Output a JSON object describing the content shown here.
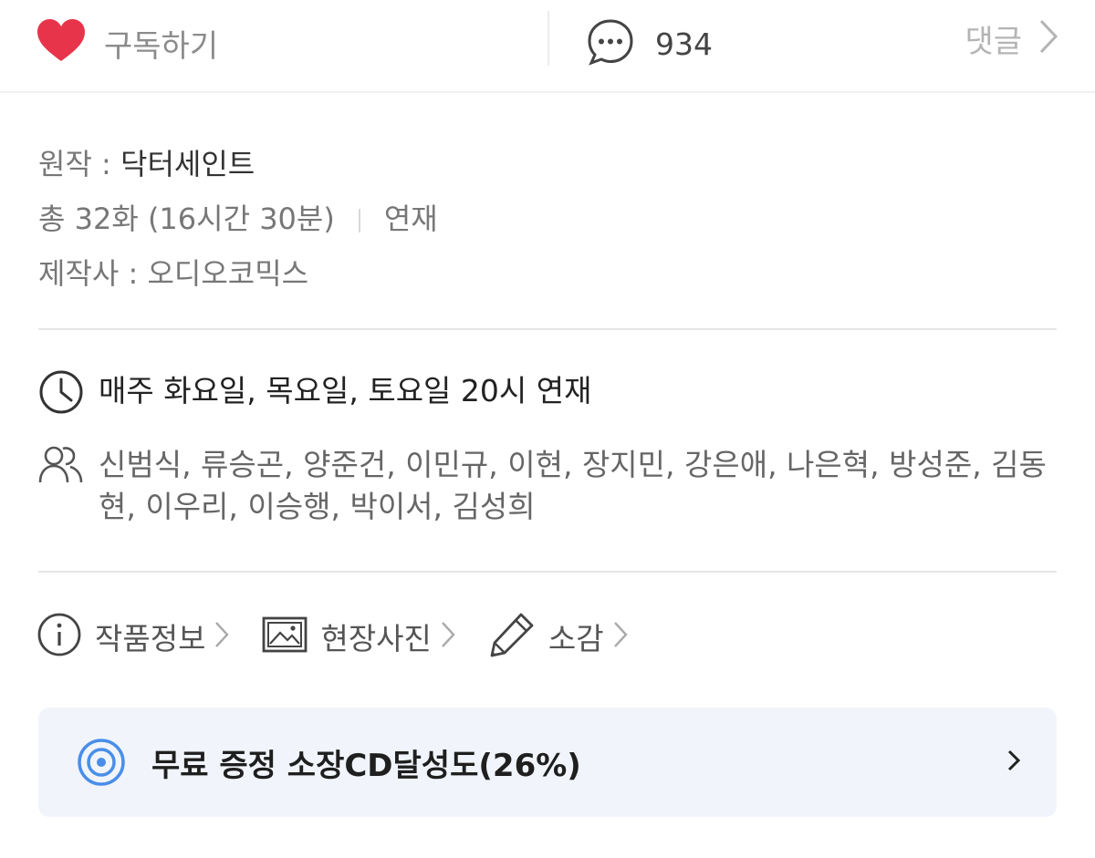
{
  "topbar": {
    "subscribe_label": "구독하기",
    "comment_count": "934",
    "comment_link_label": "댓글",
    "heart_color": "#e8344a"
  },
  "info": {
    "original_label": "원작 : ",
    "original_value": "닥터세인트",
    "episodes": "총 32화 (16시간 30분)",
    "status": "연재",
    "producer_label": "제작사 : ",
    "producer_value": "오디오코믹스"
  },
  "schedule": {
    "text": "매주 화요일, 목요일, 토요일 20시 연재"
  },
  "cast": {
    "text": "신범식, 류승곤, 양준건, 이민규, 이현, 장지민, 강은애, 나은혁, 방성준, 김동현, 이우리, 이승행, 박이서, 김성희"
  },
  "links": [
    {
      "label": "작품정보",
      "icon": "info-icon"
    },
    {
      "label": "현장사진",
      "icon": "image-icon"
    },
    {
      "label": "소감",
      "icon": "pencil-icon"
    }
  ],
  "cd_progress": {
    "label": "무료 증정 소장CD달성도(26%)",
    "percent": 26,
    "accent_color": "#4a8ee8"
  }
}
